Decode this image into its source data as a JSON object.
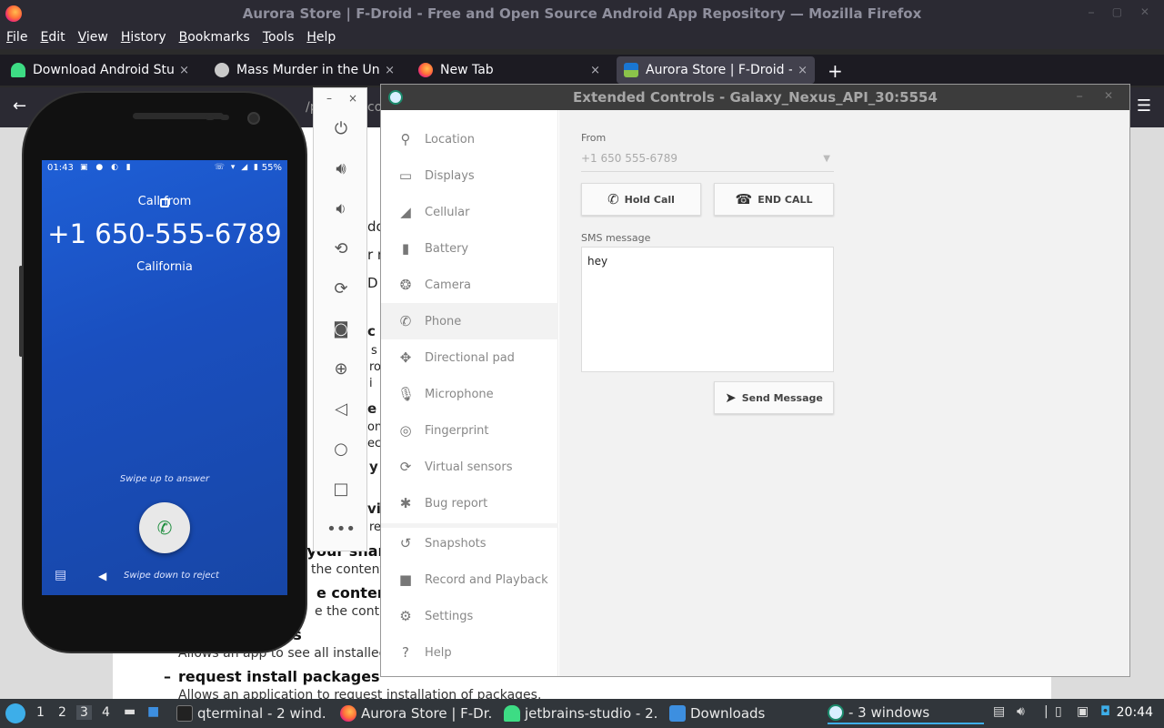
{
  "firefox": {
    "window_title": "Aurora Store | F-Droid - Free and Open Source Android App Repository — Mozilla Firefox",
    "menu": [
      "File",
      "Edit",
      "View",
      "History",
      "Bookmarks",
      "Tools",
      "Help"
    ],
    "tabs": [
      {
        "label": "Download Android Studio",
        "close": "×"
      },
      {
        "label": "Mass Murder in the Unite",
        "close": "×"
      },
      {
        "label": "New Tab",
        "close": "×"
      },
      {
        "label": "Aurora Store | F-Droid - F",
        "close": "×"
      }
    ],
    "new_tab": "+",
    "url_fragment": "/pa",
    "url_fragment2": "co"
  },
  "webpage": {
    "fragments": [
      "do",
      "r n",
      "D",
      "l g",
      "c",
      "s",
      "ro",
      "i",
      "d",
      "e",
      "on",
      "ec",
      "y",
      "vi",
      "re"
    ],
    "permissions": [
      {
        "title": "of your shar",
        "desc": "the contents"
      },
      {
        "title": "e contents",
        "desc": "e the content"
      },
      {
        "title": "ges",
        "desc": "Allows an app to see all installed pa"
      },
      {
        "title": "request install packages",
        "desc": "Allows an application to request installation of packages."
      }
    ],
    "bullet": "–"
  },
  "phone": {
    "time": "01:43",
    "battery": "55%",
    "call_from": "Call from",
    "number": "+1 650-555-6789",
    "location": "California",
    "swipe_up": "Swipe up to answer",
    "swipe_down": "Swipe down to reject"
  },
  "emulator_toolbar": {
    "minimize": "–",
    "close": "×"
  },
  "extended_controls": {
    "title": "Extended Controls - Galaxy_Nexus_API_30:5554",
    "sidebar": [
      {
        "label": "Location",
        "icon": "location-icon"
      },
      {
        "label": "Displays",
        "icon": "display-icon"
      },
      {
        "label": "Cellular",
        "icon": "cellular-icon"
      },
      {
        "label": "Battery",
        "icon": "battery-icon"
      },
      {
        "label": "Camera",
        "icon": "camera-icon"
      },
      {
        "label": "Phone",
        "icon": "phone-icon"
      },
      {
        "label": "Directional pad",
        "icon": "dpad-icon"
      },
      {
        "label": "Microphone",
        "icon": "microphone-icon"
      },
      {
        "label": "Fingerprint",
        "icon": "fingerprint-icon"
      },
      {
        "label": "Virtual sensors",
        "icon": "sensors-icon"
      },
      {
        "label": "Bug report",
        "icon": "bug-icon"
      },
      {
        "label": "Snapshots",
        "icon": "history-icon"
      },
      {
        "label": "Record and Playback",
        "icon": "video-icon"
      },
      {
        "label": "Settings",
        "icon": "gear-icon"
      },
      {
        "label": "Help",
        "icon": "help-icon"
      }
    ],
    "active_item": "Phone",
    "phone_panel": {
      "from_label": "From",
      "from_value": "+1 650 555-6789",
      "hold_call": "Hold Call",
      "end_call": "END CALL",
      "sms_label": "SMS message",
      "sms_value": "hey",
      "send_message": "Send Message"
    }
  },
  "taskbar": {
    "desktops": [
      "1",
      "2",
      "3",
      "4"
    ],
    "active_desktop": "3",
    "tasks": [
      {
        "label": "qterminal - 2 wind..."
      },
      {
        "label": "Aurora Store | F-Dr..."
      },
      {
        "label": "jetbrains-studio - 2..."
      },
      {
        "label": "Downloads"
      },
      {
        "label": "- 3 windows"
      }
    ],
    "clock": "20:44"
  },
  "colors": {
    "firefox_dark": "#2b2a33",
    "phone_blue": "#1a4fbf",
    "answer_green": "#1e8e3e",
    "taskbar": "#31363b",
    "accent": "#3daee9"
  }
}
